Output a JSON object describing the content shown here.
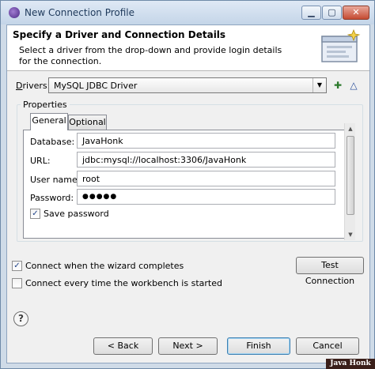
{
  "window": {
    "title": "New Connection Profile",
    "min_glyph": "▁",
    "max_glyph": "▢",
    "close_glyph": "✕"
  },
  "header": {
    "title": "Specify a Driver and Connection Details",
    "description": "Select a driver from the drop-down and provide login details for the connection."
  },
  "drivers": {
    "label_prefix": "D",
    "label_rest": "rivers:",
    "selected": "MySQL JDBC Driver",
    "new_icon": "✚",
    "edit_icon": "△"
  },
  "properties": {
    "group_label": "Properties",
    "tabs": [
      {
        "label": "General"
      },
      {
        "label": "Optional"
      }
    ],
    "fields": {
      "database": {
        "label": "Database:",
        "value": "JavaHonk"
      },
      "url": {
        "label": "URL:",
        "value": "jdbc:mysql://localhost:3306/JavaHonk"
      },
      "username": {
        "label": "User name:",
        "value": "root"
      },
      "password": {
        "label": "Password:",
        "value": "●●●●●"
      }
    },
    "save_password": {
      "label": "Save password",
      "checked": true
    }
  },
  "options": {
    "connect_when_complete": {
      "label": "Connect when the wizard completes",
      "checked": true
    },
    "connect_every_time": {
      "label": "Connect every time the workbench is started",
      "checked": false
    }
  },
  "buttons": {
    "test_connection": "Test Connection",
    "back": "< Back",
    "next": "Next >",
    "finish": "Finish",
    "cancel": "Cancel",
    "help": "?"
  },
  "watermark": "Java Honk"
}
